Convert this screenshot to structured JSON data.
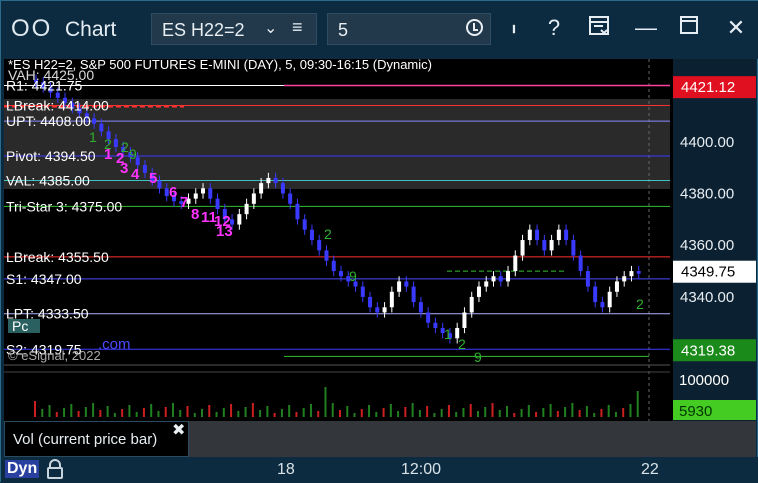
{
  "window": {
    "title": "Chart",
    "symbol": "ES H22=2",
    "interval": "5"
  },
  "chart": {
    "header": "*ES H22=2, S&P 500 FUTURES E-MINI (DAY), 5, 09:30-16:15 (Dynamic)",
    "watermark": "© eSignal, 2022",
    "levels": [
      {
        "label": "R1: 4421.75",
        "price": 4421.75,
        "color": "#ffffff"
      },
      {
        "label": "LBreak: 4414.00",
        "price": 4414.0,
        "color": "#ff3030"
      },
      {
        "label": "UPT: 4408.00",
        "price": 4408.0,
        "color": "#8a8aff"
      },
      {
        "label": "Pivot: 4394.50",
        "price": 4394.5,
        "color": "#3a3aff"
      },
      {
        "label": "VAL: 4385.00",
        "price": 4385.0,
        "color": "#40c0c0"
      },
      {
        "label": "Tri-Star 3: 4375.00",
        "price": 4375.0,
        "color": "#30c030"
      },
      {
        "label": "LBreak: 4355.50",
        "price": 4355.5,
        "color": "#ff3030"
      },
      {
        "label": "S1: 4347.00",
        "price": 4347.0,
        "color": "#4a4aff"
      },
      {
        "label": "LPT: 4333.50",
        "price": 4333.5,
        "color": "#b0b0ff"
      },
      {
        "label": "S2: 4319.75",
        "price": 4319.75,
        "color": "#3a3aff"
      }
    ],
    "overlay_labels": [
      "VAH: 4425.00",
      "Pc",
      ".com"
    ],
    "price_ticks": [
      "4400.00",
      "4380.00",
      "4360.00",
      "4340.00"
    ],
    "price_range": [
      4316,
      4432
    ],
    "price_markers": [
      {
        "label": "4421.12",
        "bg": "#e01020",
        "fg": "#ffffff"
      },
      {
        "label": "4349.75",
        "bg": "#ffffff",
        "fg": "#000000"
      },
      {
        "label": "4319.38",
        "bg": "#1a8a1a",
        "fg": "#ffffff"
      }
    ],
    "td_counts": [
      "1",
      "2",
      "3",
      "4",
      "5",
      "6",
      "7",
      "8",
      "11",
      "12",
      "13"
    ],
    "td_setup_counts": [
      "1",
      "2",
      "2",
      "9",
      "2",
      "9",
      "1",
      "2",
      "9",
      "2"
    ]
  },
  "volume": {
    "tick": "100000",
    "current": "5930",
    "current_bg": "#44cc22",
    "label": "Vol (current price bar)"
  },
  "time_axis": {
    "mode": "Dyn",
    "ticks": [
      "18",
      "12:00",
      "22"
    ]
  }
}
